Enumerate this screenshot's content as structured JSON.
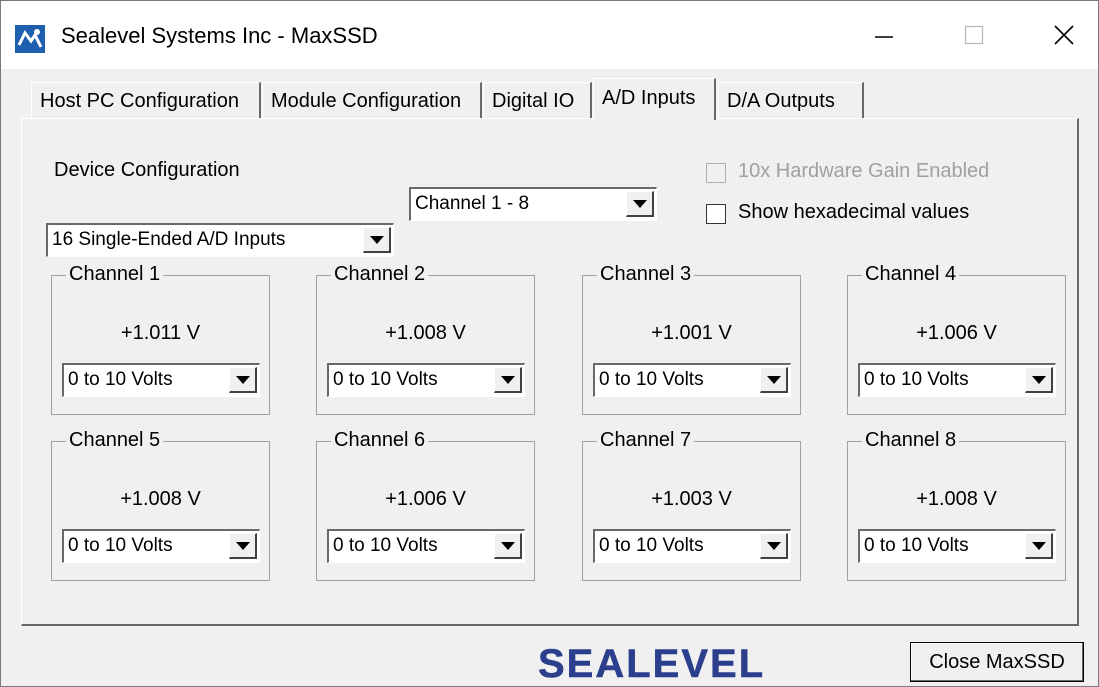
{
  "window": {
    "title": "Sealevel Systems Inc - MaxSSD"
  },
  "titlebar_buttons": {
    "minimize_icon": "minimize-icon",
    "maximize_icon": "maximize-icon",
    "close_icon": "close-icon"
  },
  "tabs": [
    {
      "label": "Host PC Configuration"
    },
    {
      "label": "Module Configuration"
    },
    {
      "label": "Digital IO"
    },
    {
      "label": "A/D Inputs"
    },
    {
      "label": "D/A Outputs"
    }
  ],
  "active_tab": "A/D Inputs",
  "ad_inputs": {
    "device_config_label": "Device Configuration",
    "device_config_value": "16 Single-Ended A/D Inputs",
    "channel_range_value": "Channel 1 - 8",
    "gain_checkbox_label": "10x Hardware Gain Enabled",
    "gain_checked": false,
    "gain_enabled": false,
    "hex_checkbox_label": "Show hexadecimal values",
    "hex_checked": false,
    "channels": [
      {
        "name": "Channel 1",
        "value": "+1.011 V",
        "range": "0 to 10 Volts"
      },
      {
        "name": "Channel 2",
        "value": "+1.008 V",
        "range": "0 to 10 Volts"
      },
      {
        "name": "Channel 3",
        "value": "+1.001 V",
        "range": "0 to 10 Volts"
      },
      {
        "name": "Channel 4",
        "value": "+1.006 V",
        "range": "0 to 10 Volts"
      },
      {
        "name": "Channel 5",
        "value": "+1.008 V",
        "range": "0 to 10 Volts"
      },
      {
        "name": "Channel 6",
        "value": "+1.006 V",
        "range": "0 to 10 Volts"
      },
      {
        "name": "Channel 7",
        "value": "+1.003 V",
        "range": "0 to 10 Volts"
      },
      {
        "name": "Channel 8",
        "value": "+1.008 V",
        "range": "0 to 10 Volts"
      }
    ]
  },
  "footer": {
    "logo_text": "SEALEVEL",
    "close_button_label": "Close MaxSSD"
  },
  "colors": {
    "logo_blue": "#2b3f8c",
    "app_icon_blue": "#1f5fb0",
    "face": "#f0f0f0"
  }
}
